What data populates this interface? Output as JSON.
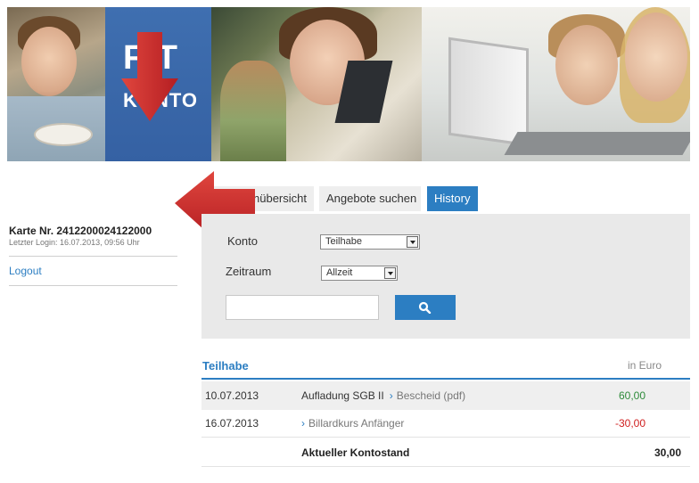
{
  "banner": {
    "logo_top": "FIT",
    "logo_bottom": "KONTO"
  },
  "tabs": [
    {
      "label": "Kontenübersicht",
      "visible_label": "nübersicht",
      "active": false
    },
    {
      "label": "Angebote suchen",
      "active": false
    },
    {
      "label": "History",
      "active": true
    }
  ],
  "filters": {
    "konto_label": "Konto",
    "konto_value": "Teilhabe",
    "zeitraum_label": "Zeitraum",
    "zeitraum_value": "Allzeit",
    "search_value": ""
  },
  "sidebar": {
    "card_title": "Karte Nr. 2412200024122000",
    "last_login": "Letzter Login: 16.07.2013, 09:56 Uhr",
    "logout": "Logout"
  },
  "table": {
    "title": "Teilhabe",
    "unit": "in Euro",
    "rows": [
      {
        "date": "10.07.2013",
        "desc": "Aufladung SGB II",
        "link": "Bescheid (pdf)",
        "amount": "60,00"
      },
      {
        "date": "16.07.2013",
        "desc": "",
        "link": "Billardkurs Anfänger",
        "amount": "-30,00"
      }
    ],
    "total_label": "Aktueller Kontostand",
    "total_amount": "30,00"
  },
  "colors": {
    "accent": "#2c7ec2",
    "positive": "#2e8b3a",
    "negative": "#d02020",
    "annotation_arrow": "#c8262a"
  }
}
